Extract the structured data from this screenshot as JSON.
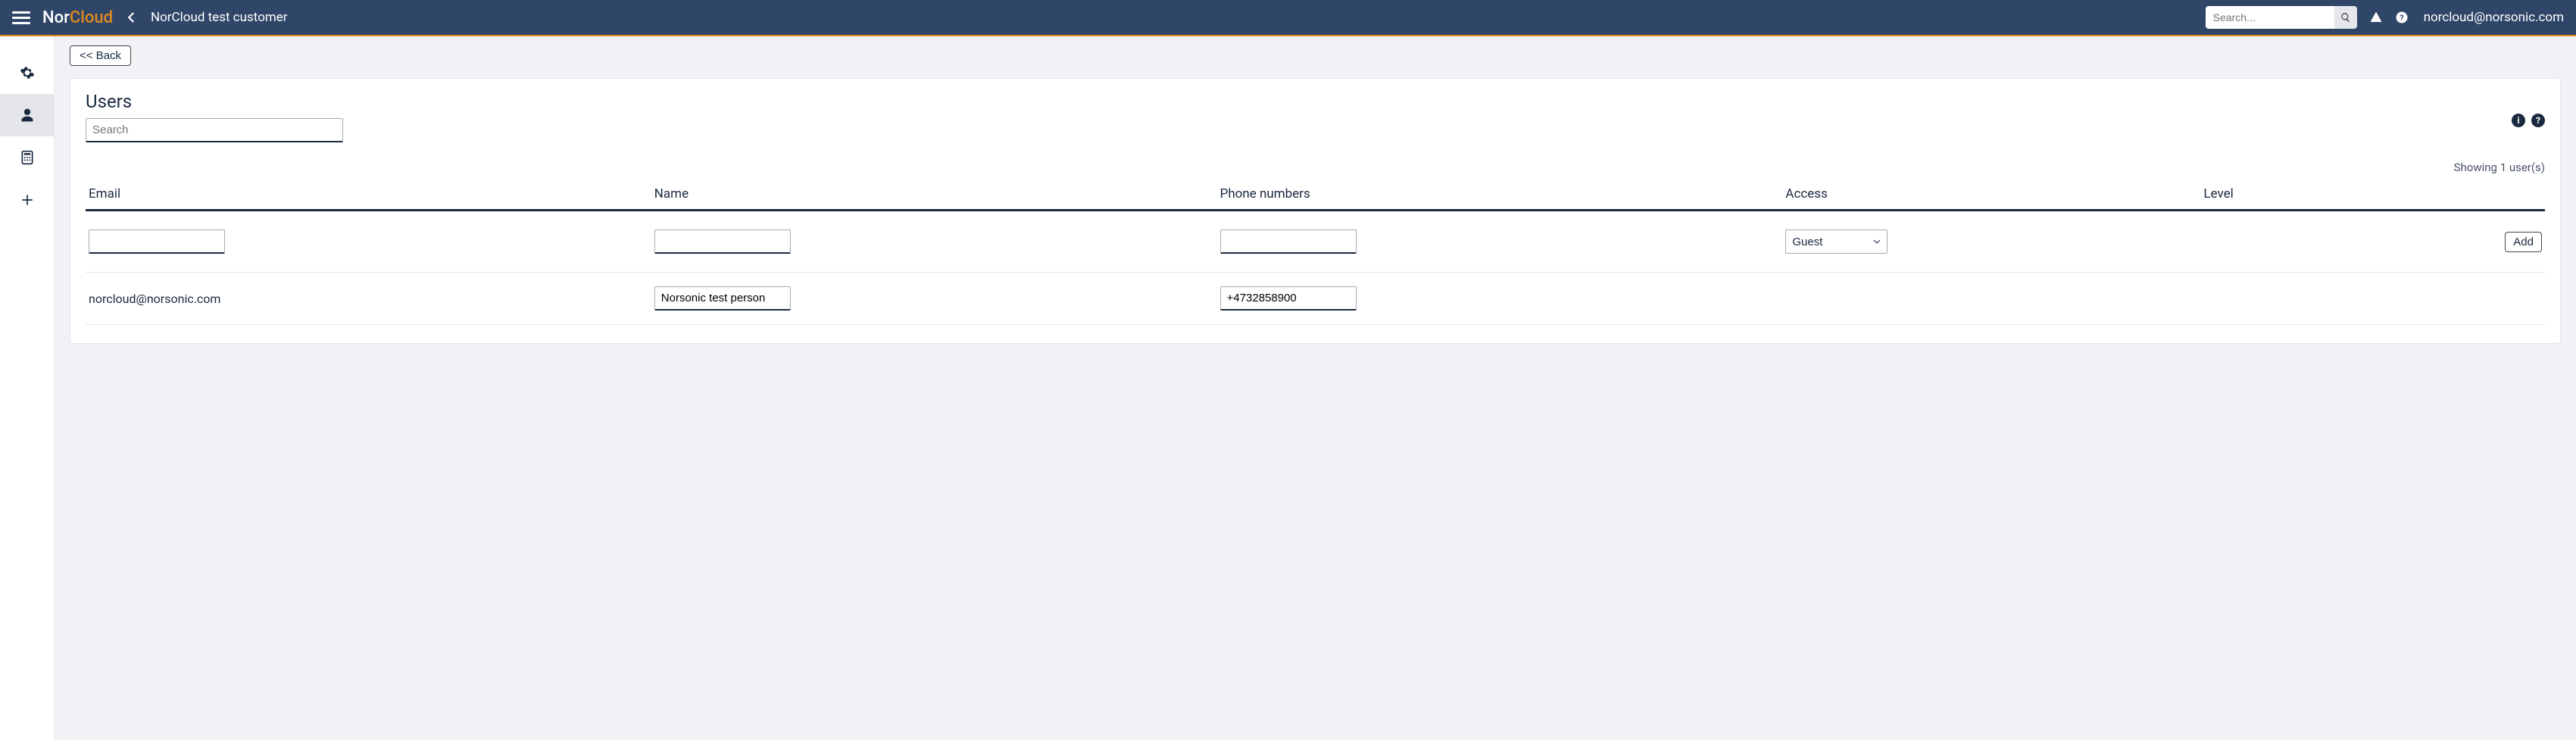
{
  "brand": {
    "prefix": "Nor",
    "suffix": "Cloud"
  },
  "customer_name": "NorCloud test customer",
  "search_placeholder": "Search...",
  "top_user_email": "norcloud@norsonic.com",
  "back_button": "<< Back",
  "panel": {
    "title": "Users",
    "filter_placeholder": "Search",
    "count_text": "Showing 1 user(s)",
    "columns": {
      "email": "Email",
      "name": "Name",
      "phone": "Phone numbers",
      "access": "Access",
      "level": "Level"
    },
    "entry_row": {
      "access_selected": "Guest",
      "add_label": "Add"
    },
    "rows": [
      {
        "email": "norcloud@norsonic.com",
        "name": "Norsonic test person",
        "phone": "+4732858900"
      }
    ]
  }
}
